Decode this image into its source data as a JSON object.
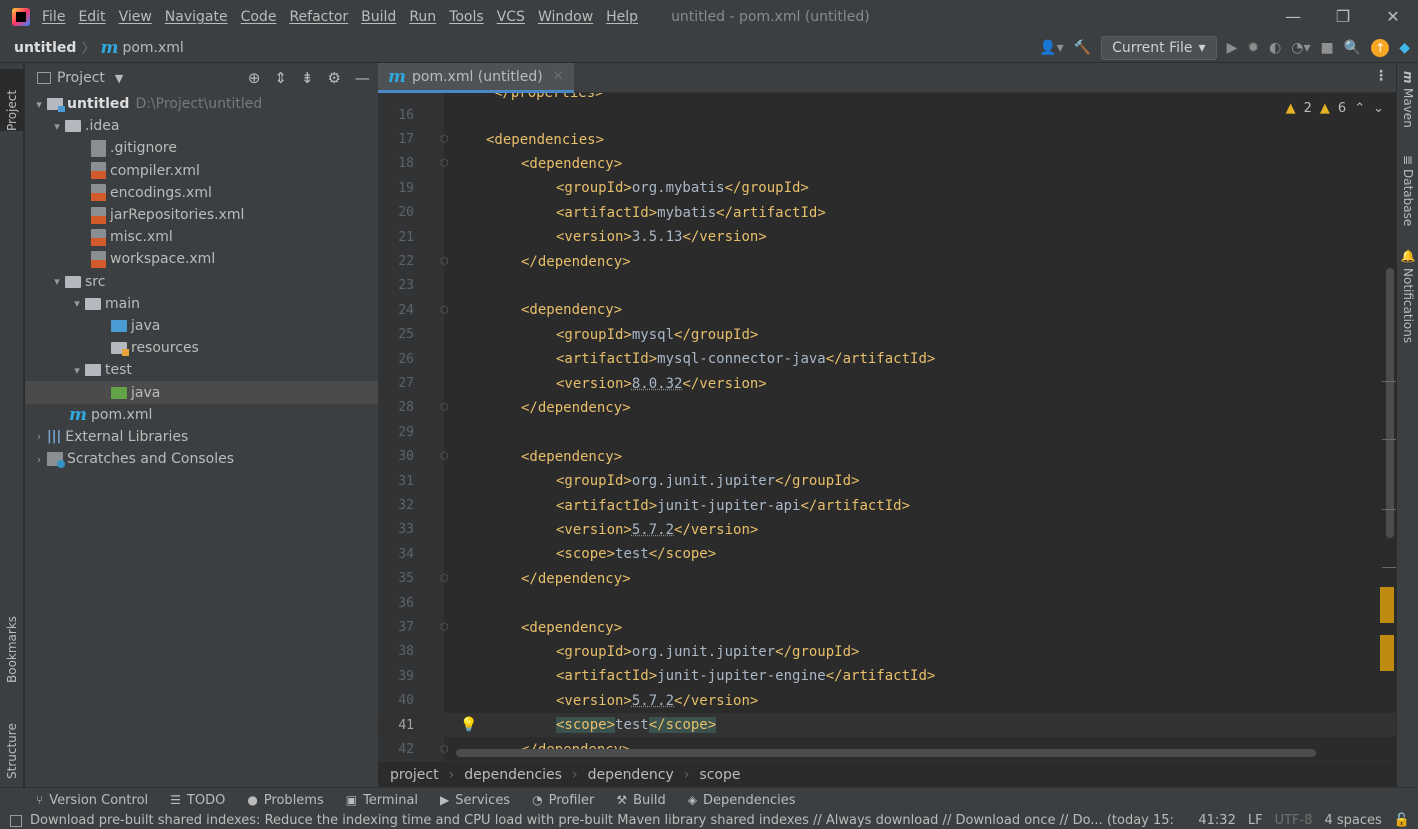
{
  "menubar": {
    "items": [
      "File",
      "Edit",
      "View",
      "Navigate",
      "Code",
      "Refactor",
      "Build",
      "Run",
      "Tools",
      "VCS",
      "Window",
      "Help"
    ],
    "title": "untitled - pom.xml (untitled)",
    "minimize": "—",
    "restore": "❐",
    "close": "✕"
  },
  "navbar": {
    "project": "untitled",
    "file": "pom.xml",
    "run_config": "Current File"
  },
  "left_stripe": {
    "project": "Project",
    "bookmarks": "Bookmarks",
    "structure": "Structure"
  },
  "right_stripe": {
    "maven": "Maven",
    "database": "Database",
    "notifications": "Notifications"
  },
  "project_panel": {
    "title": "Project",
    "tree": [
      {
        "label": "untitled",
        "hint": "D:\\Project\\untitled"
      },
      {
        "label": ".idea"
      },
      {
        "label": ".gitignore"
      },
      {
        "label": "compiler.xml"
      },
      {
        "label": "encodings.xml"
      },
      {
        "label": "jarRepositories.xml"
      },
      {
        "label": "misc.xml"
      },
      {
        "label": "workspace.xml"
      },
      {
        "label": "src"
      },
      {
        "label": "main"
      },
      {
        "label": "java"
      },
      {
        "label": "resources"
      },
      {
        "label": "test"
      },
      {
        "label": "java"
      },
      {
        "label": "pom.xml"
      },
      {
        "label": "External Libraries"
      },
      {
        "label": "Scratches and Consoles"
      }
    ]
  },
  "editor": {
    "tab_label": "pom.xml (untitled)",
    "warnings": {
      "a": "2",
      "b": "6"
    },
    "top_partial": "</properties>",
    "lines": [
      {
        "n": "16",
        "code": ""
      },
      {
        "n": "17",
        "code": "<dependencies>"
      },
      {
        "n": "18",
        "code": "<dependency>"
      },
      {
        "n": "19",
        "open": "<groupId>",
        "val": "org.mybatis",
        "close": "</groupId>"
      },
      {
        "n": "20",
        "open": "<artifactId>",
        "val": "mybatis",
        "close": "</artifactId>"
      },
      {
        "n": "21",
        "open": "<version>",
        "val": "3.5.13",
        "close": "</version>"
      },
      {
        "n": "22",
        "code": "</dependency>"
      },
      {
        "n": "23",
        "code": ""
      },
      {
        "n": "24",
        "code": "<dependency>"
      },
      {
        "n": "25",
        "open": "<groupId>",
        "val": "mysql",
        "close": "</groupId>"
      },
      {
        "n": "26",
        "open": "<artifactId>",
        "val": "mysql-connector-java",
        "close": "</artifactId>"
      },
      {
        "n": "27",
        "open": "<version>",
        "val": "8.0.32",
        "close": "</version>"
      },
      {
        "n": "28",
        "code": "</dependency>"
      },
      {
        "n": "29",
        "code": ""
      },
      {
        "n": "30",
        "code": "<dependency>"
      },
      {
        "n": "31",
        "open": "<groupId>",
        "val": "org.junit.jupiter",
        "close": "</groupId>"
      },
      {
        "n": "32",
        "open": "<artifactId>",
        "val": "junit-jupiter-api",
        "close": "</artifactId>"
      },
      {
        "n": "33",
        "open": "<version>",
        "val": "5.7.2",
        "close": "</version>"
      },
      {
        "n": "34",
        "open": "<scope>",
        "val": "test",
        "close": "</scope>"
      },
      {
        "n": "35",
        "code": "</dependency>"
      },
      {
        "n": "36",
        "code": ""
      },
      {
        "n": "37",
        "code": "<dependency>"
      },
      {
        "n": "38",
        "open": "<groupId>",
        "val": "org.junit.jupiter",
        "close": "</groupId>"
      },
      {
        "n": "39",
        "open": "<artifactId>",
        "val": "junit-jupiter-engine",
        "close": "</artifactId>"
      },
      {
        "n": "40",
        "open": "<version>",
        "val": "5.7.2",
        "close": "</version>"
      },
      {
        "n": "41",
        "open": "<scope>",
        "val": "test",
        "close": "</scope>"
      },
      {
        "n": "42",
        "code": "</dependency>"
      }
    ]
  },
  "breadcrumb": [
    "project",
    "dependencies",
    "dependency",
    "scope"
  ],
  "bottom_tools": [
    "Version Control",
    "TODO",
    "Problems",
    "Terminal",
    "Services",
    "Profiler",
    "Build",
    "Dependencies"
  ],
  "status": {
    "message": "Download pre-built shared indexes: Reduce the indexing time and CPU load with pre-built Maven library shared indexes // Always download // Download once // Do... (today 15:",
    "position": "41:32",
    "line_sep": "LF",
    "encoding": "UTF-8",
    "indent": "4 spaces"
  }
}
